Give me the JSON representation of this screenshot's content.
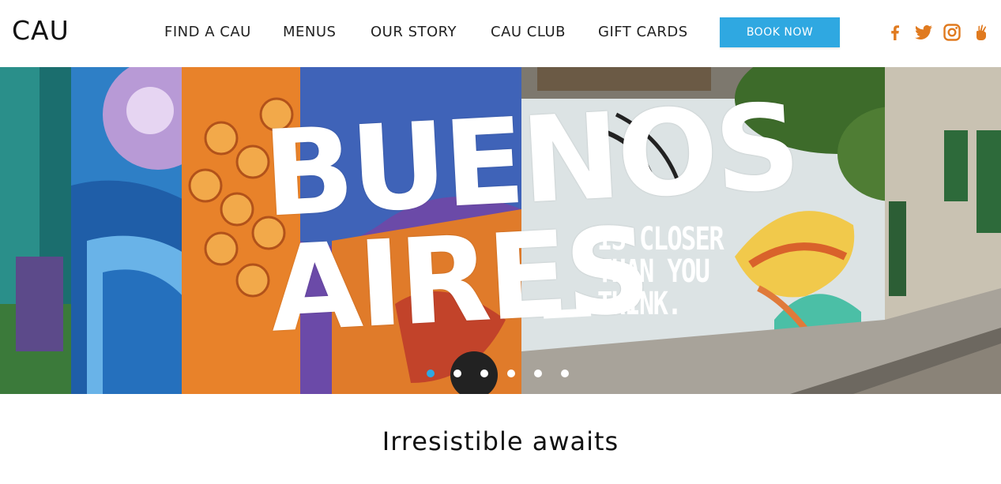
{
  "header": {
    "logo": "CAU",
    "nav": [
      {
        "label": "FIND A CAU"
      },
      {
        "label": "MENUS"
      },
      {
        "label": "OUR STORY"
      },
      {
        "label": "CAU CLUB"
      },
      {
        "label": "GIFT CARDS"
      }
    ],
    "book_button": "BOOK NOW",
    "social": [
      {
        "icon": "facebook-icon"
      },
      {
        "icon": "twitter-icon"
      },
      {
        "icon": "instagram-icon"
      },
      {
        "icon": "hand-icon"
      }
    ],
    "social_color": "#e07a1f",
    "accent_color": "#2fa8e1"
  },
  "hero": {
    "line1": "BUENOS",
    "line2": "AIRES",
    "side_text": [
      "IS CLOSER",
      "THAN YOU",
      "THINK."
    ],
    "slides_total": 6,
    "active_slide": 1
  },
  "tagline": "Irresistible awaits"
}
